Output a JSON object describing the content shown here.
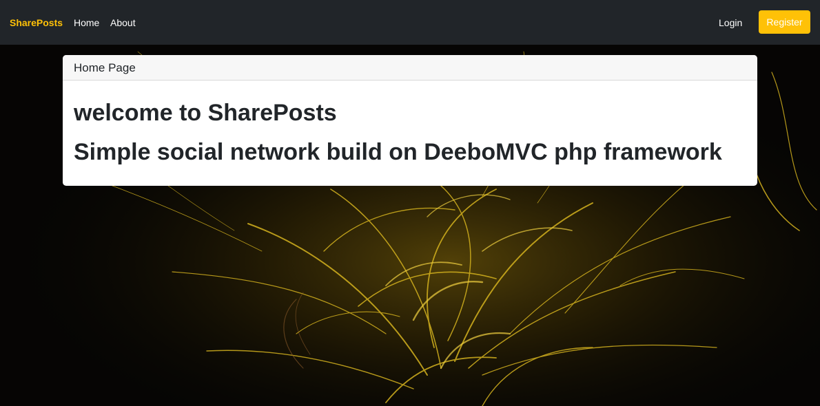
{
  "navbar": {
    "brand": "SharePosts",
    "links": [
      "Home",
      "About"
    ],
    "login": "Login",
    "register": "Register"
  },
  "card": {
    "header": "Home Page",
    "title": "welcome to SharePosts",
    "subtitle": "Simple social network build on DeeboMVC php framework"
  },
  "colors": {
    "navbar_bg": "#212529",
    "brand": "#ffc107",
    "register_bg": "#ffc107",
    "background_art": "#c9a51c"
  }
}
